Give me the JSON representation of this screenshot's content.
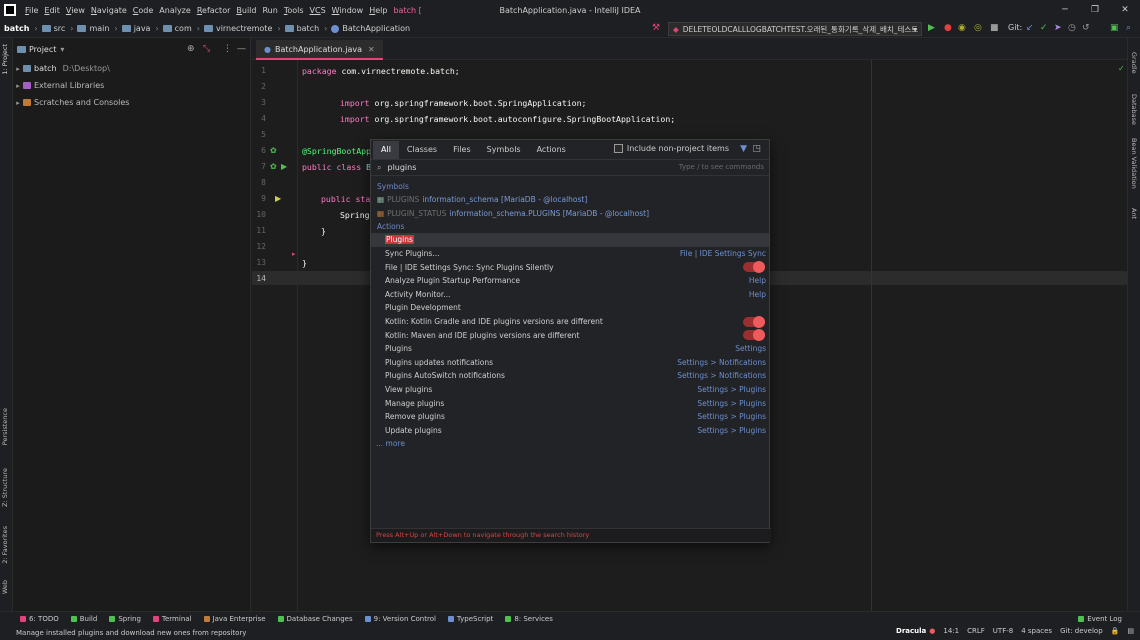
{
  "menubar": {
    "items": [
      [
        "F",
        "ile"
      ],
      [
        "E",
        "dit"
      ],
      [
        "V",
        "iew"
      ],
      [
        "N",
        "avigate"
      ],
      [
        "C",
        "ode"
      ],
      [
        "",
        "Analyze"
      ],
      [
        "R",
        "efactor"
      ],
      [
        "B",
        "uild"
      ],
      [
        "",
        "Run"
      ],
      [
        "T",
        "ools"
      ],
      [
        "VC",
        "S"
      ],
      [
        "W",
        "indow"
      ],
      [
        "H",
        "elp"
      ]
    ],
    "project_label": "batch [",
    "title": "BatchApplication.java - IntelliJ IDEA"
  },
  "breadcrumb": [
    "batch",
    "src",
    "main",
    "java",
    "com",
    "virnectremote",
    "batch",
    "BatchApplication"
  ],
  "run_config": "DELETEOLDCALLLOGBATCHTEST.오래된_통화기록_삭제_배치_테스트",
  "git_label": "Git:",
  "project": {
    "header": "Project",
    "items": [
      {
        "name": "batch",
        "path": "D:\\Desktop\\"
      },
      {
        "name": "External Libraries"
      },
      {
        "name": "Scratches and Consoles"
      }
    ]
  },
  "editor_tab": "BatchApplication.java",
  "code": {
    "l1": [
      "package ",
      "com.virnectremote.batch;"
    ],
    "l3": [
      "import ",
      "org.springframework.boot.SpringApplication;"
    ],
    "l4": [
      "import ",
      "org.springframework.boot.autoconfigure.SpringBootApplication;"
    ],
    "l6": "@SpringBootApp",
    "l7": [
      "public class ",
      "B"
    ],
    "l9": "public sta",
    "l10": "Spring",
    "l11": "}",
    "l13": "}"
  },
  "line_numbers": [
    "1",
    "2",
    "3",
    "4",
    "5",
    "6",
    "7",
    "8",
    "9",
    "10",
    "11",
    "12",
    "13",
    "14"
  ],
  "popup": {
    "tabs": [
      "All",
      "Classes",
      "Files",
      "Symbols",
      "Actions"
    ],
    "include_label": "Include non-project items",
    "query": "plugins",
    "hint": "Type / to see commands",
    "symbols_header": "Symbols",
    "symbols": [
      {
        "name": "PLUGINS",
        "detail": "information_schema [MariaDB - @localhost]"
      },
      {
        "name": "PLUGIN_STATUS",
        "detail": "information_schema.PLUGINS [MariaDB - @localhost]"
      }
    ],
    "actions_header": "Actions",
    "actions": [
      {
        "label": "Plugins",
        "right": "",
        "toggle": false,
        "highlight": true
      },
      {
        "label": "Sync Plugins...",
        "right": "File | IDE Settings Sync",
        "toggle": false
      },
      {
        "label": "File | IDE Settings Sync: Sync Plugins Silently",
        "right": "",
        "toggle": true
      },
      {
        "label": "Analyze Plugin Startup Performance",
        "right": "Help",
        "toggle": false
      },
      {
        "label": "Activity Monitor...",
        "right": "Help",
        "toggle": false
      },
      {
        "label": "Plugin Development",
        "right": "",
        "toggle": false
      },
      {
        "label": "Kotlin: Kotlin Gradle and IDE plugins versions are different",
        "right": "",
        "toggle": true
      },
      {
        "label": "Kotlin: Maven and IDE plugins versions are different",
        "right": "",
        "toggle": true
      },
      {
        "label": "Plugins",
        "right": "Settings",
        "toggle": false
      },
      {
        "label": "Plugins updates notifications",
        "right": "Settings > Notifications",
        "toggle": false
      },
      {
        "label": "Plugins AutoSwitch notifications",
        "right": "Settings > Notifications",
        "toggle": false
      },
      {
        "label": "View plugins",
        "right": "Settings > Plugins",
        "toggle": false
      },
      {
        "label": "Manage plugins",
        "right": "Settings > Plugins",
        "toggle": false
      },
      {
        "label": "Remove plugins",
        "right": "Settings > Plugins",
        "toggle": false
      },
      {
        "label": "Update plugins",
        "right": "Settings > Plugins",
        "toggle": false
      }
    ],
    "more": "... more",
    "footer": "Press Alt+Up or Alt+Down to navigate through the search history"
  },
  "left_strip": [
    "1: Project",
    "Persistence",
    "Z: Structure",
    "2: Favorites",
    "Web"
  ],
  "right_strip": [
    "Gradle",
    "Database",
    "Bean Validation",
    "Ant"
  ],
  "bottom_tabs": [
    "6: TODO",
    "Build",
    "Spring",
    "Terminal",
    "Java Enterprise",
    "Database Changes",
    "9: Version Control",
    "TypeScript",
    "8: Services"
  ],
  "event_log": "Event Log",
  "status": {
    "message": "Manage installed plugins and download new ones from repository",
    "theme": "Dracula",
    "position": "14:1",
    "line_sep": "CRLF",
    "encoding": "UTF-8",
    "indent": "4 spaces",
    "branch": "Git: develop"
  },
  "colors": {
    "accent": "#e0447a",
    "link": "#6b8fd0",
    "toggle": "#f05a5a"
  }
}
